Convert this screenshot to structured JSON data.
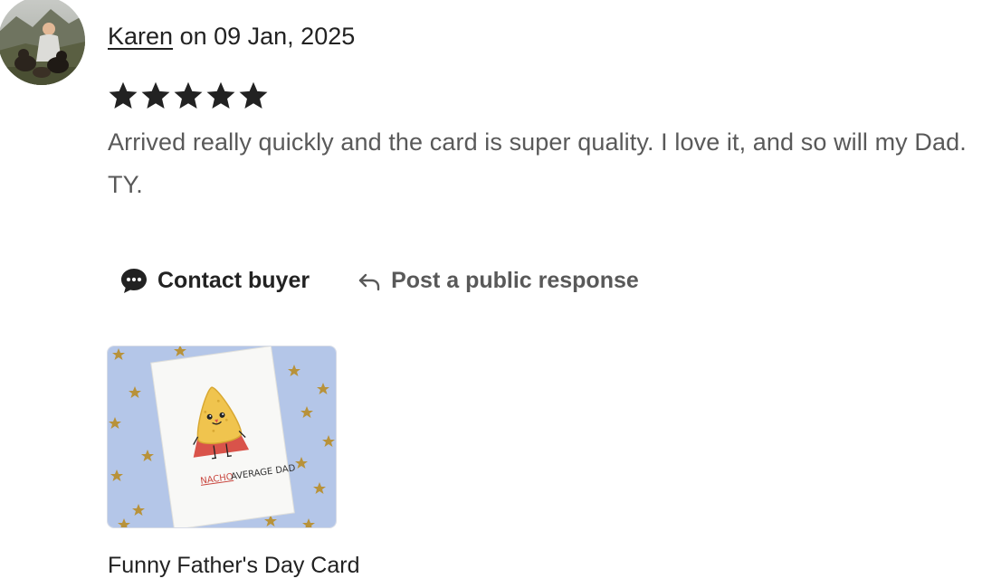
{
  "review": {
    "author": "Karen",
    "date_text": "on 09 Jan, 2025",
    "rating": 5,
    "rating_max": 5,
    "text": "Arrived really quickly and the card is super quality. I love it, and so will my Dad. TY."
  },
  "actions": {
    "contact_label": "Contact buyer",
    "respond_label": "Post a public response"
  },
  "listing": {
    "title": "Funny Father's Day Card",
    "card_text_highlight": "NACHO",
    "card_text_rest": "AVERAGE DAD"
  },
  "icons": {
    "contact": "speech-bubble-icon",
    "respond": "reply-arrow-icon",
    "star": "star-icon"
  },
  "colors": {
    "text_primary": "#222222",
    "text_secondary": "#595959",
    "card_background": "#b4c6e8",
    "star_fill": "#222222"
  }
}
